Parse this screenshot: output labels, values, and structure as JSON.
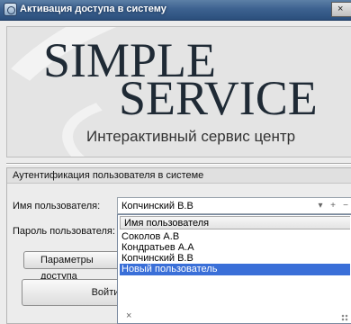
{
  "window": {
    "title": "Активация доступа в систему",
    "close_glyph": "×"
  },
  "banner": {
    "logo_line1": "SIMPLE",
    "logo_line2": "SERVICE",
    "tagline": "Интерактивный сервис центр"
  },
  "auth_group": {
    "header": "Аутентификация пользователя в системе",
    "username_label": "Имя пользователя:",
    "password_label": "Пароль пользователя:",
    "username_value": "Копчинский В.В",
    "combo_buttons": {
      "dropdown": "▾",
      "add": "+",
      "remove": "−"
    }
  },
  "dropdown": {
    "column_header": "Имя пользователя",
    "items": [
      {
        "label": "Соколов А.В"
      },
      {
        "label": "Кондратьев А.А"
      },
      {
        "label": "Копчинский В.В"
      },
      {
        "label": "Новый пользователь"
      }
    ],
    "selected_index": 3,
    "close_glyph": "×"
  },
  "buttons": {
    "params_label": "Параметры доступа",
    "login_label": "Войти"
  },
  "colors": {
    "titlebar": "#3d6290",
    "selection": "#3a6fd8"
  }
}
